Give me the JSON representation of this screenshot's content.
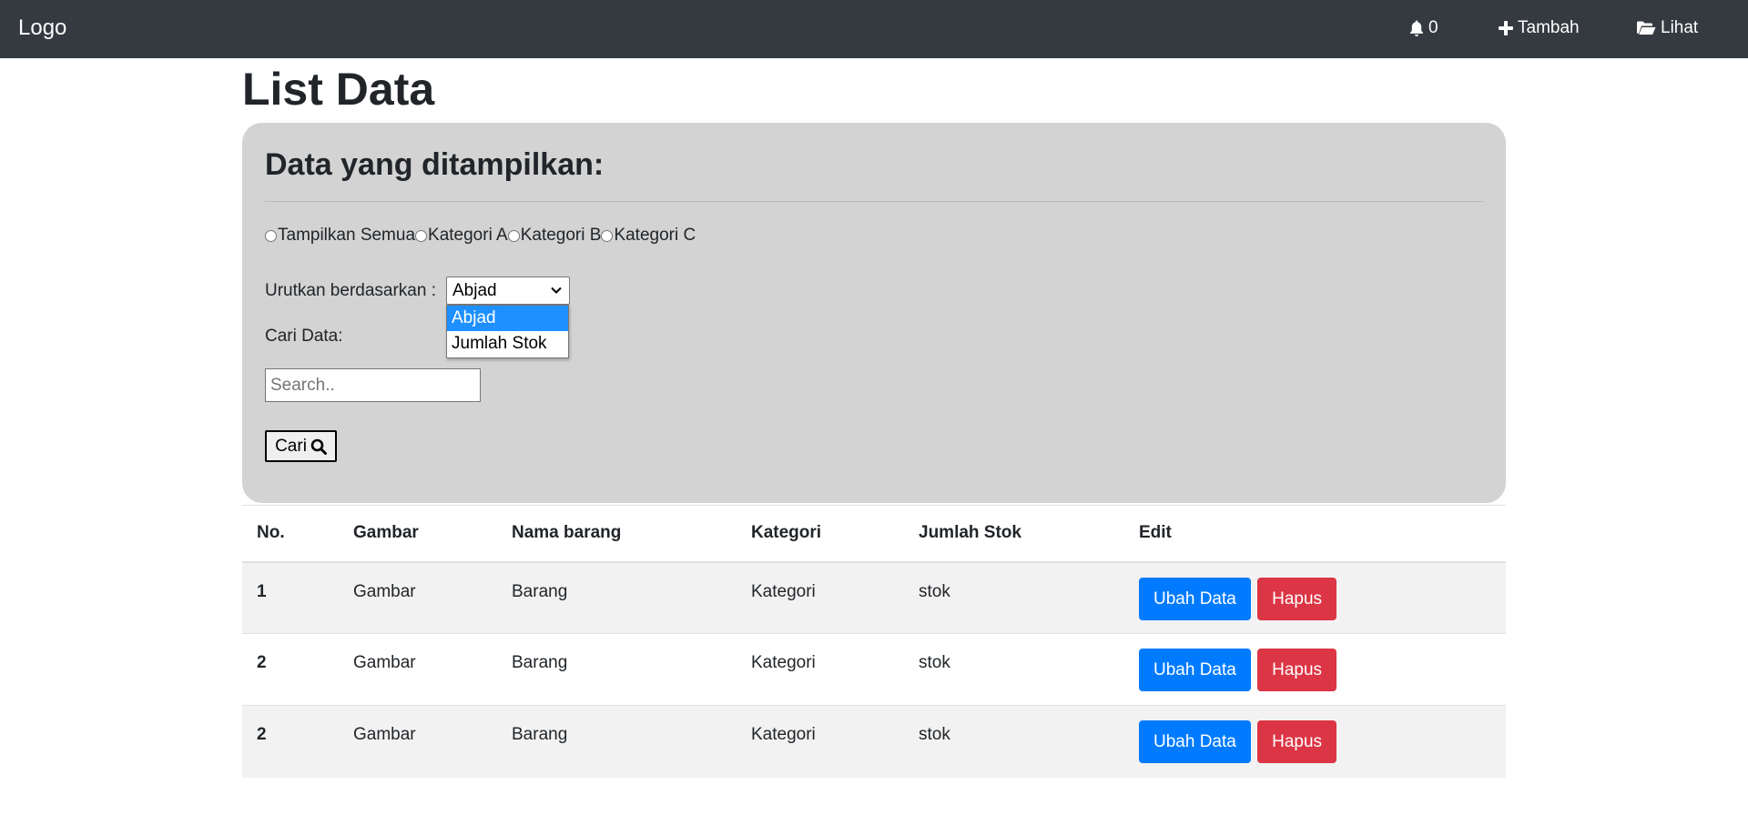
{
  "navbar": {
    "brand": "Logo",
    "notif_count": "0",
    "tambah_label": "Tambah",
    "lihat_label": "Lihat"
  },
  "page": {
    "title": "List Data"
  },
  "filter": {
    "title": "Data yang ditampilkan:",
    "radios": [
      "Tampilkan Semua",
      "Kategori A",
      "Kategori B",
      "Kategori C"
    ],
    "sort_label": "Urutkan berdasarkan :",
    "sort_selected": "Abjad",
    "sort_options": [
      "Abjad",
      "Jumlah Stok"
    ],
    "search_label": "Cari Data:",
    "search_placeholder": "Search..",
    "search_value": "",
    "search_button": "Cari"
  },
  "table": {
    "headers": [
      "No.",
      "Gambar",
      "Nama barang",
      "Kategori",
      "Jumlah Stok",
      "Edit"
    ],
    "rows": [
      {
        "no": "1",
        "gambar": "Gambar",
        "nama": "Barang",
        "kategori": "Kategori",
        "stok": "stok"
      },
      {
        "no": "2",
        "gambar": "Gambar",
        "nama": "Barang",
        "kategori": "Kategori",
        "stok": "stok"
      },
      {
        "no": "2",
        "gambar": "Gambar",
        "nama": "Barang",
        "kategori": "Kategori",
        "stok": "stok"
      }
    ],
    "edit_label": "Ubah Data",
    "delete_label": "Hapus"
  },
  "colors": {
    "navbar": "#343a40",
    "panel": "#d3d3d3",
    "edit_button": "#007bff",
    "delete_button": "#dc3545",
    "dropdown_highlight": "#1e90ff"
  },
  "icons": {
    "bell": "bell-icon",
    "plus": "plus-icon",
    "folder": "folder-open-icon",
    "search": "search-icon",
    "chevron": "chevron-down-icon"
  }
}
